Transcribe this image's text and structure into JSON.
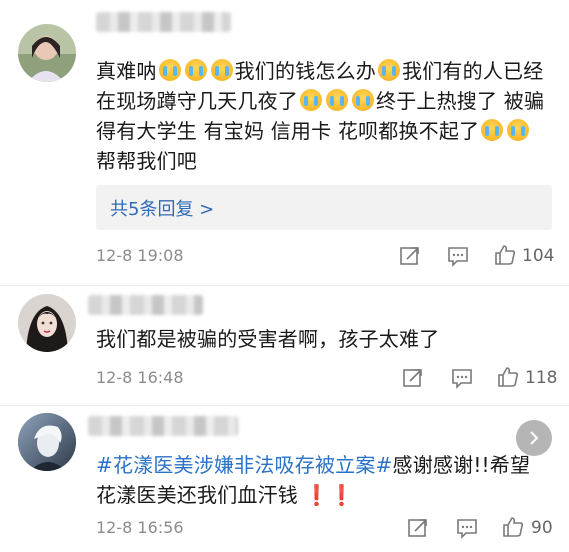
{
  "comments": [
    {
      "text_parts": [
        "真难呐",
        "我们的钱怎么办",
        "我们有的人已经在现场蹲守几天几夜了",
        "终于上热搜了 被骗得有大学生 有宝妈 信用卡 花呗都换不起了",
        "帮帮我们吧"
      ],
      "replies_label": "共5条回复 >",
      "time": "12-8 19:08",
      "likes": "104"
    },
    {
      "text": "我们都是被骗的受害者啊，孩子太难了",
      "time": "12-8 16:48",
      "likes": "118"
    },
    {
      "hashtag": "#花漾医美涉嫌非法吸存被立案#",
      "text_after": "感谢感谢!!希望花漾医美还我们血汗钱",
      "alert_icons": "❗❗",
      "time": "12-8 16:56",
      "likes": "90"
    }
  ],
  "icons": {
    "share": "share-icon",
    "comment": "comment-icon",
    "like": "thumbs-up-icon",
    "next": "chevron-right-icon",
    "emoji": "crying-face-icon"
  },
  "colors": {
    "hashtag": "#2a72c8",
    "replies_link": "#2f6cb5",
    "meta": "#8c8c8c",
    "alert": "#d8211c"
  }
}
